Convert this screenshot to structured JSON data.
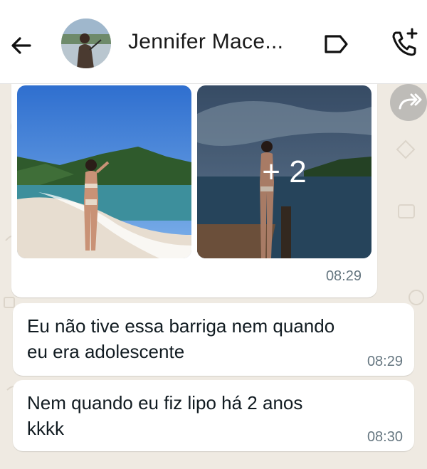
{
  "header": {
    "contact_name": "Jennifer Mace...",
    "icons": [
      "back-arrow-icon",
      "contact-avatar",
      "label-icon",
      "add-call-icon"
    ]
  },
  "messages": [
    {
      "type": "media",
      "photos": [
        "beach-photo",
        "lake-pier-photo"
      ],
      "more_count": "+ 2",
      "time": "08:29"
    },
    {
      "type": "text",
      "lines": [
        "Eu não tive essa barriga  nem quando",
        "eu era adolescente"
      ],
      "time": "08:29"
    },
    {
      "type": "text",
      "lines": [
        "Nem quando eu fiz lipo há 2 anos",
        "kkkk"
      ],
      "time": "08:30"
    }
  ],
  "colors": {
    "chat_background": "#efeae2",
    "bubble": "#ffffff",
    "timestamp": "#667781",
    "text": "#111b21"
  }
}
